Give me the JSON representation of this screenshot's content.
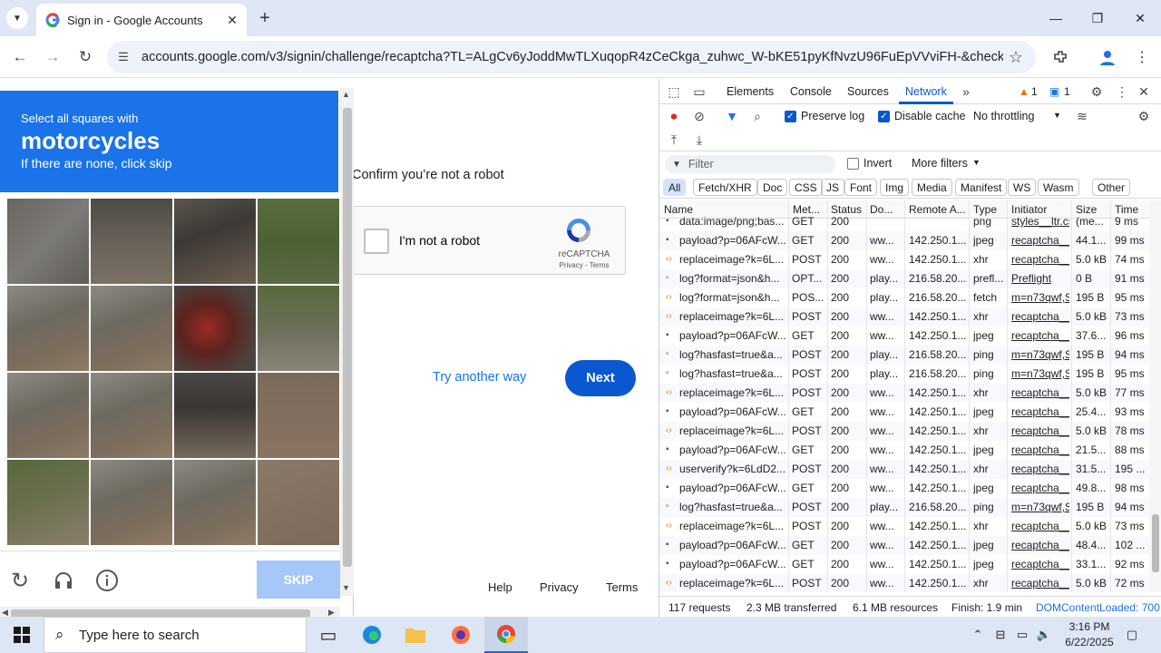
{
  "browser": {
    "tab_title": "Sign in - Google Accounts",
    "url": "accounts.google.com/v3/signin/challenge/recaptcha?TL=ALgCv6yJoddMwTLXuqopR4zCeCkga_zuhwc_W-bKE51pyKfNvzU96FuEpVVviFH-&checkConn...",
    "controls": {
      "minimize": "—",
      "restore": "❐",
      "close": "✕",
      "new_tab": "+"
    }
  },
  "page": {
    "confirm_text": "Confirm you’re not a robot",
    "recaptcha_label": "I'm not a robot",
    "recaptcha_brand": "reCAPTCHA",
    "recaptcha_terms": "Privacy - Terms",
    "try_another_way": "Try another way",
    "next": "Next",
    "footer": {
      "help": "Help",
      "privacy": "Privacy",
      "terms": "Terms"
    }
  },
  "captcha": {
    "line1": "Select all squares with",
    "target": "motorcycles",
    "line3": "If there are none, click skip",
    "skip": "SKIP"
  },
  "devtools": {
    "tabs": [
      "Elements",
      "Console",
      "Sources",
      "Network"
    ],
    "active_tab": "Network",
    "warnings_count": "1",
    "messages_count": "1",
    "preserve_log": "Preserve log",
    "disable_cache": "Disable cache",
    "throttling": "No throttling",
    "filter_placeholder": "Filter",
    "invert": "Invert",
    "more_filters": "More filters",
    "type_filters": [
      "All",
      "Fetch/XHR",
      "Doc",
      "CSS",
      "JS",
      "Font",
      "Img",
      "Media",
      "Manifest",
      "WS",
      "Wasm",
      "Other"
    ],
    "columns": [
      "Name",
      "Met...",
      "Status",
      "Do...",
      "Remote A...",
      "Type",
      "Initiator",
      "Size",
      "Time"
    ],
    "rows": [
      {
        "name": "data:image/png;bas...",
        "method": "GET",
        "status": "200",
        "domain": "",
        "remote": "",
        "type": "png",
        "initiator": "styles__ltr.css",
        "size": "(me...",
        "time": "9 ms",
        "icon": "img"
      },
      {
        "name": "payload?p=06AFcW...",
        "method": "GET",
        "status": "200",
        "domain": "ww...",
        "remote": "142.250.1...",
        "type": "jpeg",
        "initiator": "recaptcha__e",
        "size": "44.1...",
        "time": "99 ms",
        "icon": "img"
      },
      {
        "name": "replaceimage?k=6L...",
        "method": "POST",
        "status": "200",
        "domain": "ww...",
        "remote": "142.250.1...",
        "type": "xhr",
        "initiator": "recaptcha__e",
        "size": "5.0 kB",
        "time": "74 ms",
        "icon": "xhr"
      },
      {
        "name": "log?format=json&h...",
        "method": "OPT...",
        "status": "200",
        "domain": "play...",
        "remote": "216.58.20...",
        "type": "prefl...",
        "initiator": "Preflight",
        "size": "0 B",
        "time": "91 ms",
        "icon": "doc"
      },
      {
        "name": "log?format=json&h...",
        "method": "POS...",
        "status": "200",
        "domain": "play...",
        "remote": "216.58.20...",
        "type": "fetch",
        "initiator": "m=n73qwf,S",
        "size": "195 B",
        "time": "95 ms",
        "icon": "xhr"
      },
      {
        "name": "replaceimage?k=6L...",
        "method": "POST",
        "status": "200",
        "domain": "ww...",
        "remote": "142.250.1...",
        "type": "xhr",
        "initiator": "recaptcha__e",
        "size": "5.0 kB",
        "time": "73 ms",
        "icon": "xhr"
      },
      {
        "name": "payload?p=06AFcW...",
        "method": "GET",
        "status": "200",
        "domain": "ww...",
        "remote": "142.250.1...",
        "type": "jpeg",
        "initiator": "recaptcha__e",
        "size": "37.6...",
        "time": "96 ms",
        "icon": "img"
      },
      {
        "name": "log?hasfast=true&a...",
        "method": "POST",
        "status": "200",
        "domain": "play...",
        "remote": "216.58.20...",
        "type": "ping",
        "initiator": "m=n73qwf,S",
        "size": "195 B",
        "time": "94 ms",
        "icon": "doc"
      },
      {
        "name": "log?hasfast=true&a...",
        "method": "POST",
        "status": "200",
        "domain": "play...",
        "remote": "216.58.20...",
        "type": "ping",
        "initiator": "m=n73qwf,S",
        "size": "195 B",
        "time": "95 ms",
        "icon": "doc"
      },
      {
        "name": "replaceimage?k=6L...",
        "method": "POST",
        "status": "200",
        "domain": "ww...",
        "remote": "142.250.1...",
        "type": "xhr",
        "initiator": "recaptcha__e",
        "size": "5.0 kB",
        "time": "77 ms",
        "icon": "xhr"
      },
      {
        "name": "payload?p=06AFcW...",
        "method": "GET",
        "status": "200",
        "domain": "ww...",
        "remote": "142.250.1...",
        "type": "jpeg",
        "initiator": "recaptcha__e",
        "size": "25.4...",
        "time": "93 ms",
        "icon": "img"
      },
      {
        "name": "replaceimage?k=6L...",
        "method": "POST",
        "status": "200",
        "domain": "ww...",
        "remote": "142.250.1...",
        "type": "xhr",
        "initiator": "recaptcha__e",
        "size": "5.0 kB",
        "time": "78 ms",
        "icon": "xhr"
      },
      {
        "name": "payload?p=06AFcW...",
        "method": "GET",
        "status": "200",
        "domain": "ww...",
        "remote": "142.250.1...",
        "type": "jpeg",
        "initiator": "recaptcha__e",
        "size": "21.5...",
        "time": "88 ms",
        "icon": "img"
      },
      {
        "name": "userverify?k=6LdD2...",
        "method": "POST",
        "status": "200",
        "domain": "ww...",
        "remote": "142.250.1...",
        "type": "xhr",
        "initiator": "recaptcha__e",
        "size": "31.5...",
        "time": "195 ...",
        "icon": "xhr"
      },
      {
        "name": "payload?p=06AFcW...",
        "method": "GET",
        "status": "200",
        "domain": "ww...",
        "remote": "142.250.1...",
        "type": "jpeg",
        "initiator": "recaptcha__e",
        "size": "49.8...",
        "time": "98 ms",
        "icon": "img"
      },
      {
        "name": "log?hasfast=true&a...",
        "method": "POST",
        "status": "200",
        "domain": "play...",
        "remote": "216.58.20...",
        "type": "ping",
        "initiator": "m=n73qwf,S",
        "size": "195 B",
        "time": "94 ms",
        "icon": "doc"
      },
      {
        "name": "replaceimage?k=6L...",
        "method": "POST",
        "status": "200",
        "domain": "ww...",
        "remote": "142.250.1...",
        "type": "xhr",
        "initiator": "recaptcha__e",
        "size": "5.0 kB",
        "time": "73 ms",
        "icon": "xhr"
      },
      {
        "name": "payload?p=06AFcW...",
        "method": "GET",
        "status": "200",
        "domain": "ww...",
        "remote": "142.250.1...",
        "type": "jpeg",
        "initiator": "recaptcha__e",
        "size": "48.4...",
        "time": "102 ...",
        "icon": "img"
      },
      {
        "name": "payload?p=06AFcW...",
        "method": "GET",
        "status": "200",
        "domain": "ww...",
        "remote": "142.250.1...",
        "type": "jpeg",
        "initiator": "recaptcha__e",
        "size": "33.1...",
        "time": "92 ms",
        "icon": "img"
      },
      {
        "name": "replaceimage?k=6L...",
        "method": "POST",
        "status": "200",
        "domain": "ww...",
        "remote": "142.250.1...",
        "type": "xhr",
        "initiator": "recaptcha__e",
        "size": "5.0 kB",
        "time": "72 ms",
        "icon": "xhr"
      }
    ],
    "status_bar": {
      "requests": "117 requests",
      "transferred": "2.3 MB transferred",
      "resources": "6.1 MB resources",
      "finish": "Finish: 1.9 min",
      "dcl": "DOMContentLoaded: 700"
    }
  },
  "taskbar": {
    "search_placeholder": "Type here to search",
    "time": "3:16 PM",
    "date": "6/22/2025"
  }
}
